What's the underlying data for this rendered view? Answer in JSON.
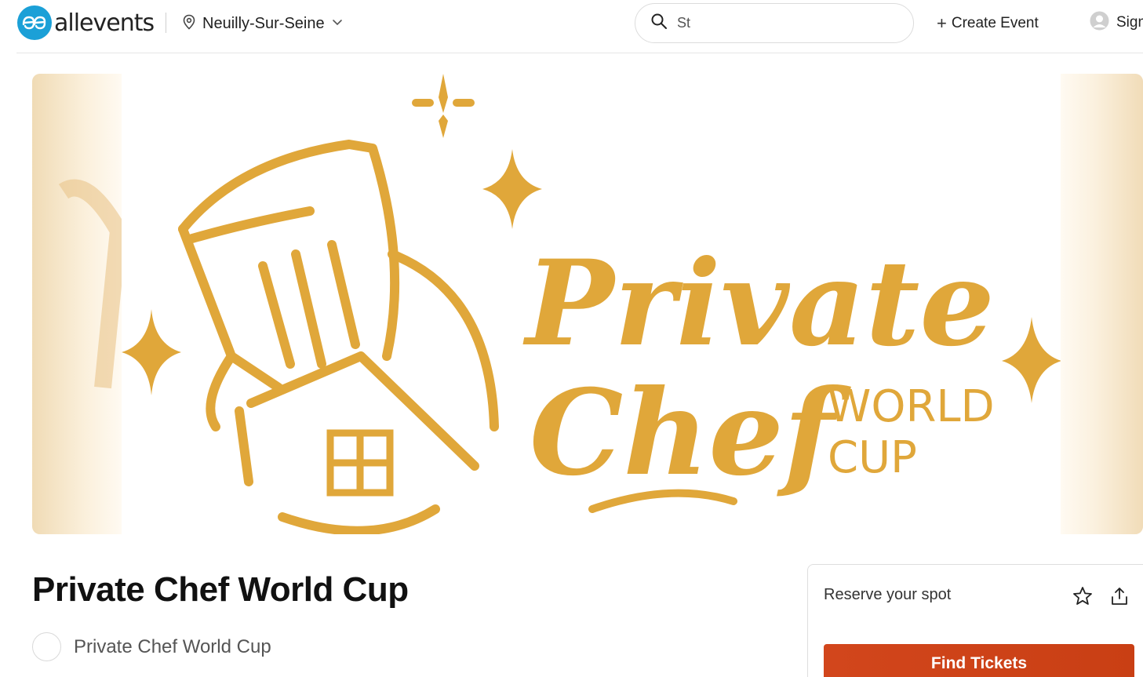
{
  "header": {
    "logo_text": "allevents",
    "location": "Neuilly-Sur-Seine",
    "search_value": "St",
    "create_event": "Create Event",
    "sign_in": "Sign in"
  },
  "banner": {
    "logo_lettering": "Private Chef WORLD CUP"
  },
  "event": {
    "title": "Private Chef World Cup",
    "organizer": "Private Chef World Cup"
  },
  "reserve": {
    "label": "Reserve your spot",
    "find_tickets": "Find Tickets"
  },
  "colors": {
    "brand_blue": "#1ba0d7",
    "gold": "#e0a73a",
    "cta_orange": "#d2461c"
  },
  "icons": [
    "location-pin-icon",
    "chevron-down-icon",
    "search-icon",
    "plus-icon",
    "user-icon",
    "star-icon",
    "share-icon"
  ]
}
